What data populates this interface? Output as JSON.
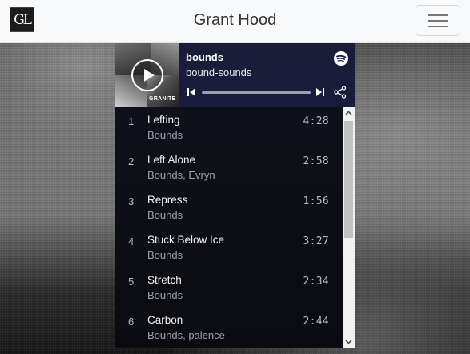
{
  "navbar": {
    "logo_text": "GL",
    "brand": "Grant Hood",
    "menu_icon": "hamburger-icon"
  },
  "player": {
    "title": "bounds",
    "artist": "bound-sounds",
    "art_label": "GRANITE",
    "progress": 0.0,
    "icons": {
      "play": "play-icon",
      "spotify": "spotify-icon",
      "previous": "skip-previous-icon",
      "next": "skip-next-icon",
      "share": "share-icon"
    },
    "colors": {
      "header_bg": "#1a1d3a",
      "list_bg": "#0d0f18"
    }
  },
  "tracks": [
    {
      "number": "1",
      "name": "Lefting",
      "artist": "Bounds",
      "duration": "4:28"
    },
    {
      "number": "2",
      "name": "Left Alone",
      "artist": "Bounds, Evryn",
      "duration": "2:58"
    },
    {
      "number": "3",
      "name": "Repress",
      "artist": "Bounds",
      "duration": "1:56"
    },
    {
      "number": "4",
      "name": "Stuck Below Ice",
      "artist": "Bounds",
      "duration": "3:27"
    },
    {
      "number": "5",
      "name": "Stretch",
      "artist": "Bounds",
      "duration": "2:34"
    },
    {
      "number": "6",
      "name": "Carbon",
      "artist": "Bounds, palence",
      "duration": "2:44"
    }
  ]
}
